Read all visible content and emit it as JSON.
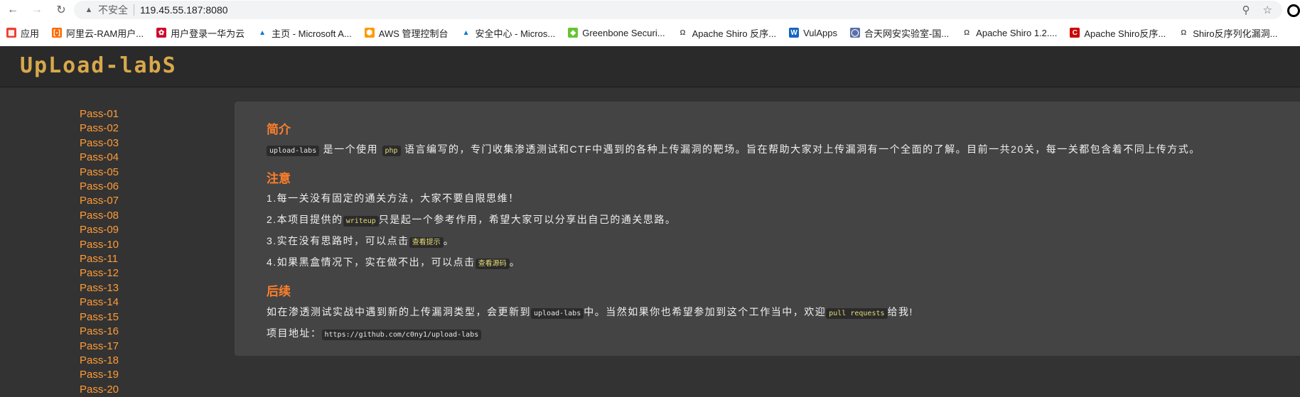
{
  "browser": {
    "insecure_label": "不安全",
    "url": "119.45.55.187:8080",
    "bookmarks": [
      "应用",
      "阿里云-RAM用户...",
      "用户登录一华为云",
      "主页 - Microsoft A...",
      "AWS 管理控制台",
      "安全中心 - Micros...",
      "Greenbone Securi...",
      "Apache Shiro 反序...",
      "VulApps",
      "合天网安实验室-国...",
      "Apache Shiro 1.2....",
      "Apache Shiro反序...",
      "Shiro反序列化漏洞..."
    ]
  },
  "site": {
    "logo": "UpLoad-labS"
  },
  "sidebar": {
    "passes": [
      "Pass-01",
      "Pass-02",
      "Pass-03",
      "Pass-04",
      "Pass-05",
      "Pass-06",
      "Pass-07",
      "Pass-08",
      "Pass-09",
      "Pass-10",
      "Pass-11",
      "Pass-12",
      "Pass-13",
      "Pass-14",
      "Pass-15",
      "Pass-16",
      "Pass-17",
      "Pass-18",
      "Pass-19",
      "Pass-20"
    ]
  },
  "content": {
    "intro_heading": "简介",
    "intro": {
      "code1": "upload-labs",
      "text1": "是一个使用",
      "code2": "php",
      "text2": "语言编写的，专门收集渗透测试和CTF中遇到的各种上传漏洞的靶场。旨在帮助大家对上传漏洞有一个全面的了解。目前一共20关，每一关都包含着不同上传方式。"
    },
    "notes_heading": "注意",
    "note1": "1.每一关没有固定的通关方法，大家不要自限思维！",
    "note2_a": "2.本项目提供的",
    "note2_code": "writeup",
    "note2_b": "只是起一个参考作用，希望大家可以分享出自己的通关思路。",
    "note3_a": "3.实在没有思路时，可以点击",
    "note3_code": "查看提示",
    "note3_b": "。",
    "note4_a": "4.如果黑盒情况下，实在做不出，可以点击",
    "note4_code": "查看源码",
    "note4_b": "。",
    "followup_heading": "后续",
    "followup_a": "如在渗透测试实战中遇到新的上传漏洞类型，会更新到",
    "followup_code1": "upload-labs",
    "followup_b": "中。当然如果你也希望参加到这个工作当中，欢迎",
    "followup_code2": "pull requests",
    "followup_c": "给我!",
    "project_label": "项目地址：",
    "project_url": "https://github.com/c0ny1/upload-labs"
  }
}
